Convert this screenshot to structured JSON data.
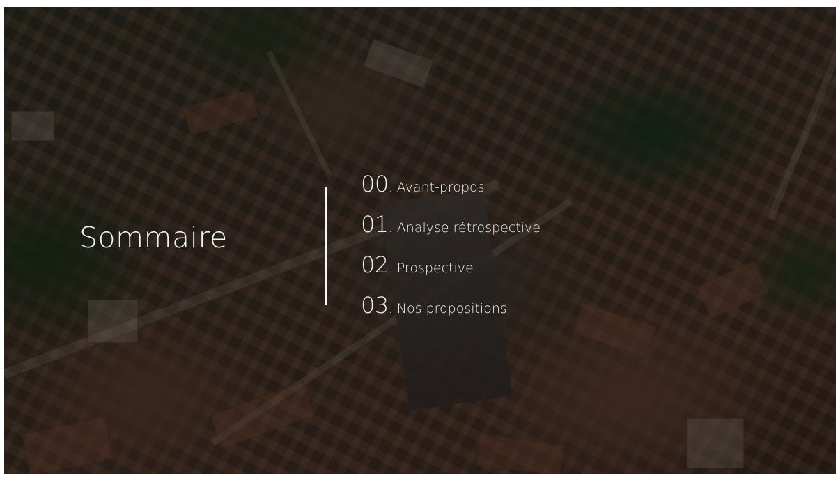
{
  "slide": {
    "title": "Sommaire",
    "items": [
      {
        "number": "00",
        "label": ". Avant-propos"
      },
      {
        "number": "01",
        "label": ". Analyse rétrospective"
      },
      {
        "number": "02",
        "label": ". Prospective"
      },
      {
        "number": "03",
        "label": ". Nos propositions"
      }
    ]
  },
  "colors": {
    "text": "#ededed",
    "overlay": "rgba(0,0,0,0.45)"
  }
}
